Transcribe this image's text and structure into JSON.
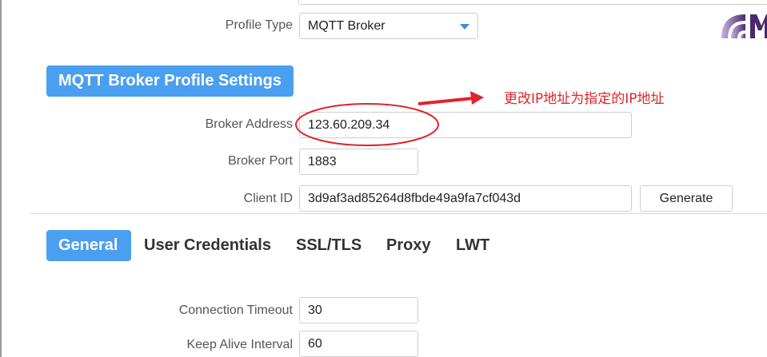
{
  "profile": {
    "type_label": "Profile Type",
    "type_value": "MQTT Broker"
  },
  "section": {
    "title": "MQTT Broker Profile Settings"
  },
  "broker": {
    "address_label": "Broker Address",
    "address_value": "123.60.209.34",
    "port_label": "Broker Port",
    "port_value": "1883",
    "client_id_label": "Client ID",
    "client_id_value": "3d9af3ad85264d8fbde49a9fa7cf043d",
    "generate_label": "Generate"
  },
  "tabs": [
    {
      "label": "General",
      "active": true
    },
    {
      "label": "User Credentials",
      "active": false
    },
    {
      "label": "SSL/TLS",
      "active": false
    },
    {
      "label": "Proxy",
      "active": false
    },
    {
      "label": "LWT",
      "active": false
    }
  ],
  "general": {
    "connection_timeout_label": "Connection Timeout",
    "connection_timeout_value": "30",
    "keep_alive_label": "Keep Alive Interval",
    "keep_alive_value": "60"
  },
  "annotation": {
    "text": "更改IP地址为指定的IP地址",
    "color": "#e0242b"
  },
  "colors": {
    "accent": "#4a9ff0",
    "annotation": "#e0242b"
  },
  "icons": {
    "logo": "mqttx-logo-icon",
    "dropdown": "chevron-down-icon"
  }
}
